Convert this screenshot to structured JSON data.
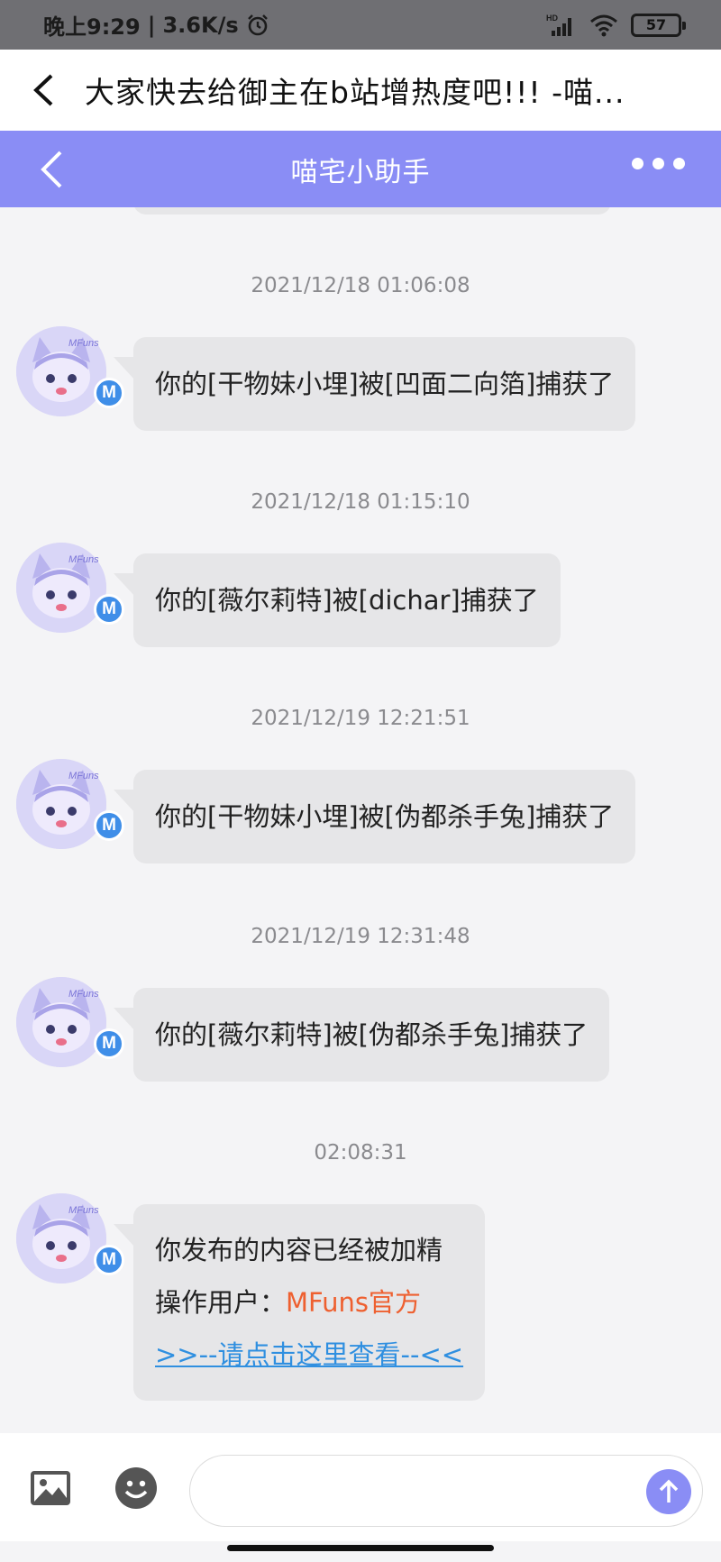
{
  "status_bar": {
    "time": "晚上9:29",
    "speed": "3.6K/s",
    "battery": "57",
    "icons": [
      "alarm-icon",
      "hd-signal-icon",
      "wifi-icon",
      "battery-icon"
    ]
  },
  "title_bar": {
    "title": "大家快去给御主在b站增热度吧!!! -喵...",
    "back_icon": "chevron-left-icon"
  },
  "app_header": {
    "title": "喵宅小助手",
    "back_icon": "chevron-left-icon",
    "more_icon": "more-dots-icon"
  },
  "messages": [
    {
      "time": "2021/12/18 01:06:08",
      "text": "你的[干物妹小埋]被[凹面二向箔]捕获了"
    },
    {
      "time": "2021/12/18 01:15:10",
      "text": "你的[薇尔莉特]被[dichar]捕获了"
    },
    {
      "time": "2021/12/19 12:21:51",
      "text": "你的[干物妹小埋]被[伪都杀手兔]捕获了"
    },
    {
      "time": "2021/12/19 12:31:48",
      "text": "你的[薇尔莉特]被[伪都杀手兔]捕获了"
    }
  ],
  "last_message": {
    "time": "02:08:31",
    "line1": "你发布的内容已经被加精",
    "operator_label": "操作用户：",
    "operator_name": "MFuns官方",
    "link": ">>--请点击这里查看--<<"
  },
  "avatar": {
    "badge": "M",
    "caption": "MFuns"
  },
  "input_bar": {
    "placeholder": "",
    "icons": [
      "image-icon",
      "emoji-icon",
      "send-arrow-icon"
    ]
  },
  "colors": {
    "header_purple": "#8a8df5",
    "operator_orange": "#ee6030",
    "link_blue": "#2f8fe0",
    "badge_blue": "#3f8ee8"
  }
}
